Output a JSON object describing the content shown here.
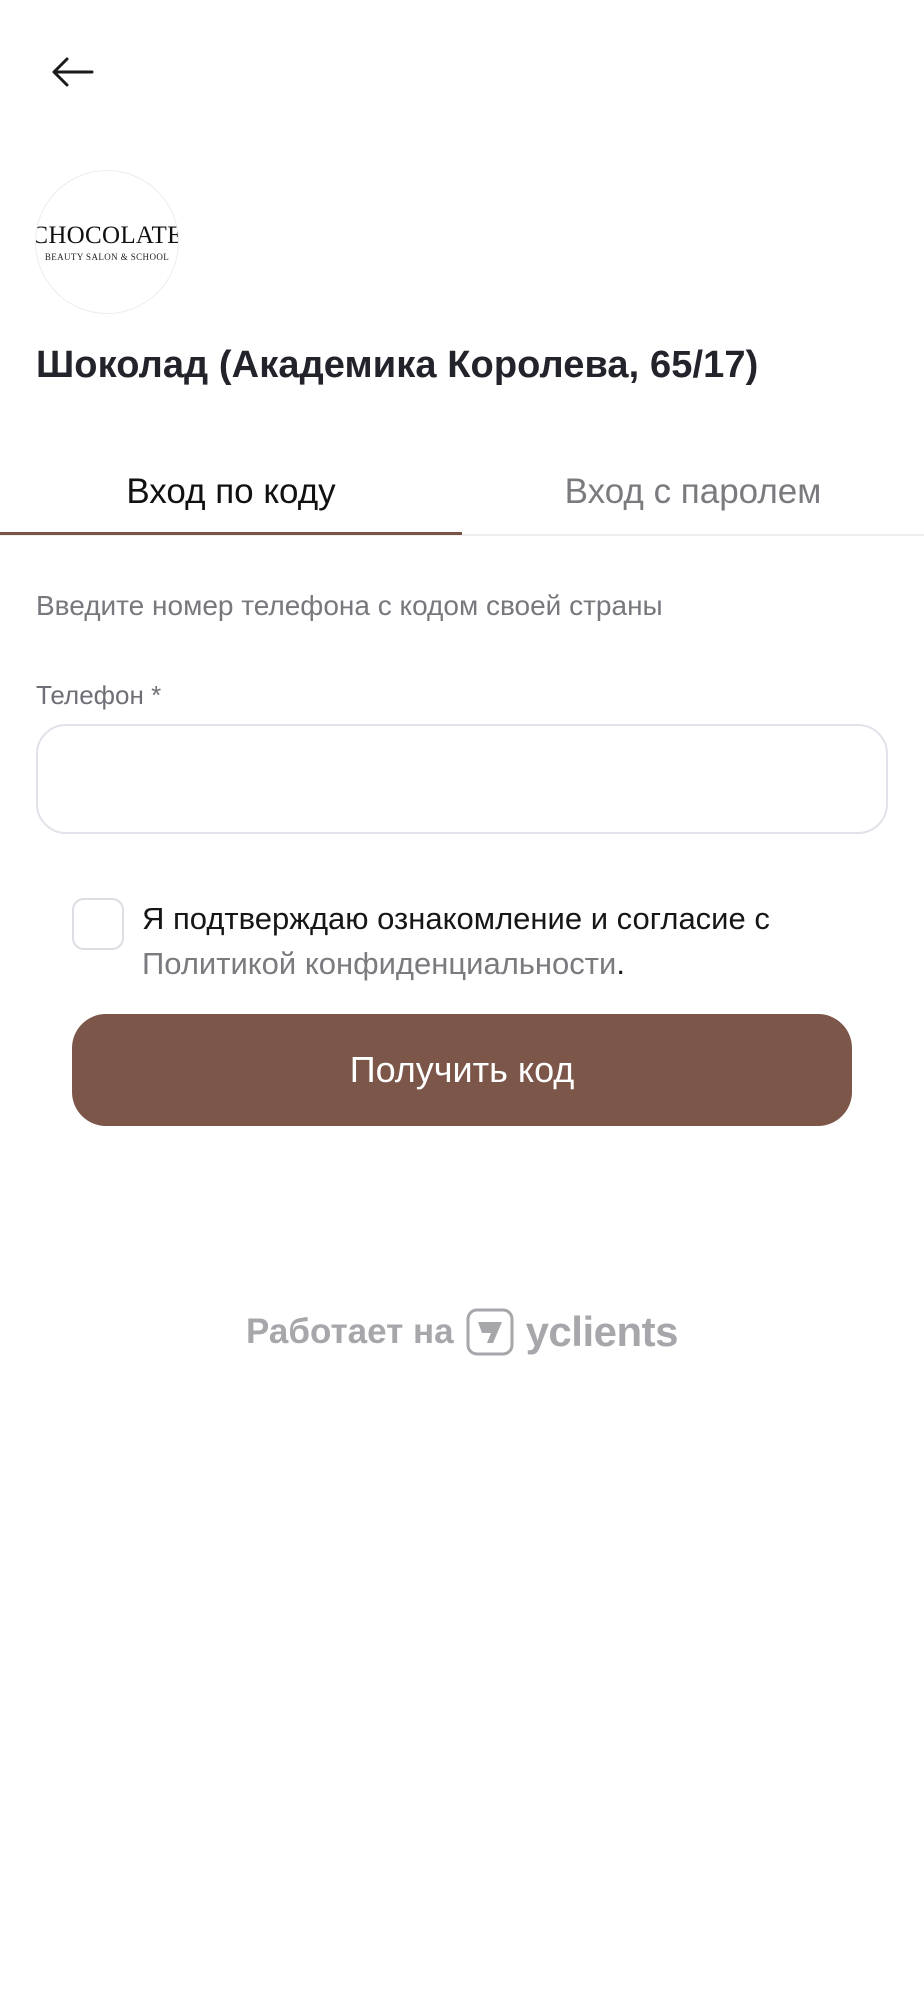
{
  "header": {
    "back_icon": "arrow-left-icon"
  },
  "logo": {
    "wordmark": "CHOCOLATE",
    "tagline": "BEAUTY SALON & SCHOOL"
  },
  "salon": {
    "title": "Шоколад (Академика Королева, 65/17)"
  },
  "tabs": [
    {
      "label": "Вход по коду",
      "active": true
    },
    {
      "label": "Вход с паролем",
      "active": false
    }
  ],
  "form": {
    "instruction": "Введите номер телефона с кодом своей страны",
    "phone_label": "Телефон *",
    "phone_value": "",
    "phone_placeholder": "",
    "consent_text": "Я подтверждаю ознакомление и согласие с",
    "consent_link": "Политикой конфиденциальности",
    "consent_suffix": ".",
    "consent_checked": false,
    "submit_label": "Получить код"
  },
  "footer": {
    "powered_text": "Работает на",
    "brand_icon": "yclients-logo-icon",
    "brand_name": "yclients"
  },
  "colors": {
    "accent": "#7b5649",
    "tab_underline": "#7b5447",
    "muted_text": "#7a7a7f",
    "footer_text": "#a7a7ab"
  }
}
